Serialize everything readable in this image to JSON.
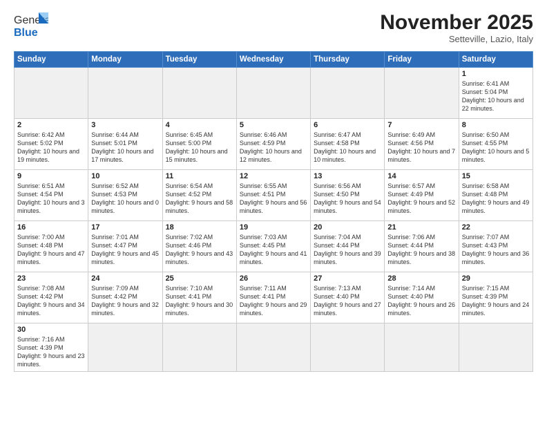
{
  "header": {
    "logo_general": "General",
    "logo_blue": "Blue",
    "month_title": "November 2025",
    "subtitle": "Setteville, Lazio, Italy"
  },
  "days_of_week": [
    "Sunday",
    "Monday",
    "Tuesday",
    "Wednesday",
    "Thursday",
    "Friday",
    "Saturday"
  ],
  "weeks": [
    [
      {
        "day": "",
        "info": ""
      },
      {
        "day": "",
        "info": ""
      },
      {
        "day": "",
        "info": ""
      },
      {
        "day": "",
        "info": ""
      },
      {
        "day": "",
        "info": ""
      },
      {
        "day": "",
        "info": ""
      },
      {
        "day": "1",
        "info": "Sunrise: 6:41 AM\nSunset: 5:04 PM\nDaylight: 10 hours and 22 minutes."
      }
    ],
    [
      {
        "day": "2",
        "info": "Sunrise: 6:42 AM\nSunset: 5:02 PM\nDaylight: 10 hours and 19 minutes."
      },
      {
        "day": "3",
        "info": "Sunrise: 6:44 AM\nSunset: 5:01 PM\nDaylight: 10 hours and 17 minutes."
      },
      {
        "day": "4",
        "info": "Sunrise: 6:45 AM\nSunset: 5:00 PM\nDaylight: 10 hours and 15 minutes."
      },
      {
        "day": "5",
        "info": "Sunrise: 6:46 AM\nSunset: 4:59 PM\nDaylight: 10 hours and 12 minutes."
      },
      {
        "day": "6",
        "info": "Sunrise: 6:47 AM\nSunset: 4:58 PM\nDaylight: 10 hours and 10 minutes."
      },
      {
        "day": "7",
        "info": "Sunrise: 6:49 AM\nSunset: 4:56 PM\nDaylight: 10 hours and 7 minutes."
      },
      {
        "day": "8",
        "info": "Sunrise: 6:50 AM\nSunset: 4:55 PM\nDaylight: 10 hours and 5 minutes."
      }
    ],
    [
      {
        "day": "9",
        "info": "Sunrise: 6:51 AM\nSunset: 4:54 PM\nDaylight: 10 hours and 3 minutes."
      },
      {
        "day": "10",
        "info": "Sunrise: 6:52 AM\nSunset: 4:53 PM\nDaylight: 10 hours and 0 minutes."
      },
      {
        "day": "11",
        "info": "Sunrise: 6:54 AM\nSunset: 4:52 PM\nDaylight: 9 hours and 58 minutes."
      },
      {
        "day": "12",
        "info": "Sunrise: 6:55 AM\nSunset: 4:51 PM\nDaylight: 9 hours and 56 minutes."
      },
      {
        "day": "13",
        "info": "Sunrise: 6:56 AM\nSunset: 4:50 PM\nDaylight: 9 hours and 54 minutes."
      },
      {
        "day": "14",
        "info": "Sunrise: 6:57 AM\nSunset: 4:49 PM\nDaylight: 9 hours and 52 minutes."
      },
      {
        "day": "15",
        "info": "Sunrise: 6:58 AM\nSunset: 4:48 PM\nDaylight: 9 hours and 49 minutes."
      }
    ],
    [
      {
        "day": "16",
        "info": "Sunrise: 7:00 AM\nSunset: 4:48 PM\nDaylight: 9 hours and 47 minutes."
      },
      {
        "day": "17",
        "info": "Sunrise: 7:01 AM\nSunset: 4:47 PM\nDaylight: 9 hours and 45 minutes."
      },
      {
        "day": "18",
        "info": "Sunrise: 7:02 AM\nSunset: 4:46 PM\nDaylight: 9 hours and 43 minutes."
      },
      {
        "day": "19",
        "info": "Sunrise: 7:03 AM\nSunset: 4:45 PM\nDaylight: 9 hours and 41 minutes."
      },
      {
        "day": "20",
        "info": "Sunrise: 7:04 AM\nSunset: 4:44 PM\nDaylight: 9 hours and 39 minutes."
      },
      {
        "day": "21",
        "info": "Sunrise: 7:06 AM\nSunset: 4:44 PM\nDaylight: 9 hours and 38 minutes."
      },
      {
        "day": "22",
        "info": "Sunrise: 7:07 AM\nSunset: 4:43 PM\nDaylight: 9 hours and 36 minutes."
      }
    ],
    [
      {
        "day": "23",
        "info": "Sunrise: 7:08 AM\nSunset: 4:42 PM\nDaylight: 9 hours and 34 minutes."
      },
      {
        "day": "24",
        "info": "Sunrise: 7:09 AM\nSunset: 4:42 PM\nDaylight: 9 hours and 32 minutes."
      },
      {
        "day": "25",
        "info": "Sunrise: 7:10 AM\nSunset: 4:41 PM\nDaylight: 9 hours and 30 minutes."
      },
      {
        "day": "26",
        "info": "Sunrise: 7:11 AM\nSunset: 4:41 PM\nDaylight: 9 hours and 29 minutes."
      },
      {
        "day": "27",
        "info": "Sunrise: 7:13 AM\nSunset: 4:40 PM\nDaylight: 9 hours and 27 minutes."
      },
      {
        "day": "28",
        "info": "Sunrise: 7:14 AM\nSunset: 4:40 PM\nDaylight: 9 hours and 26 minutes."
      },
      {
        "day": "29",
        "info": "Sunrise: 7:15 AM\nSunset: 4:39 PM\nDaylight: 9 hours and 24 minutes."
      }
    ],
    [
      {
        "day": "30",
        "info": "Sunrise: 7:16 AM\nSunset: 4:39 PM\nDaylight: 9 hours and 23 minutes."
      },
      {
        "day": "",
        "info": ""
      },
      {
        "day": "",
        "info": ""
      },
      {
        "day": "",
        "info": ""
      },
      {
        "day": "",
        "info": ""
      },
      {
        "day": "",
        "info": ""
      },
      {
        "day": "",
        "info": ""
      }
    ]
  ]
}
